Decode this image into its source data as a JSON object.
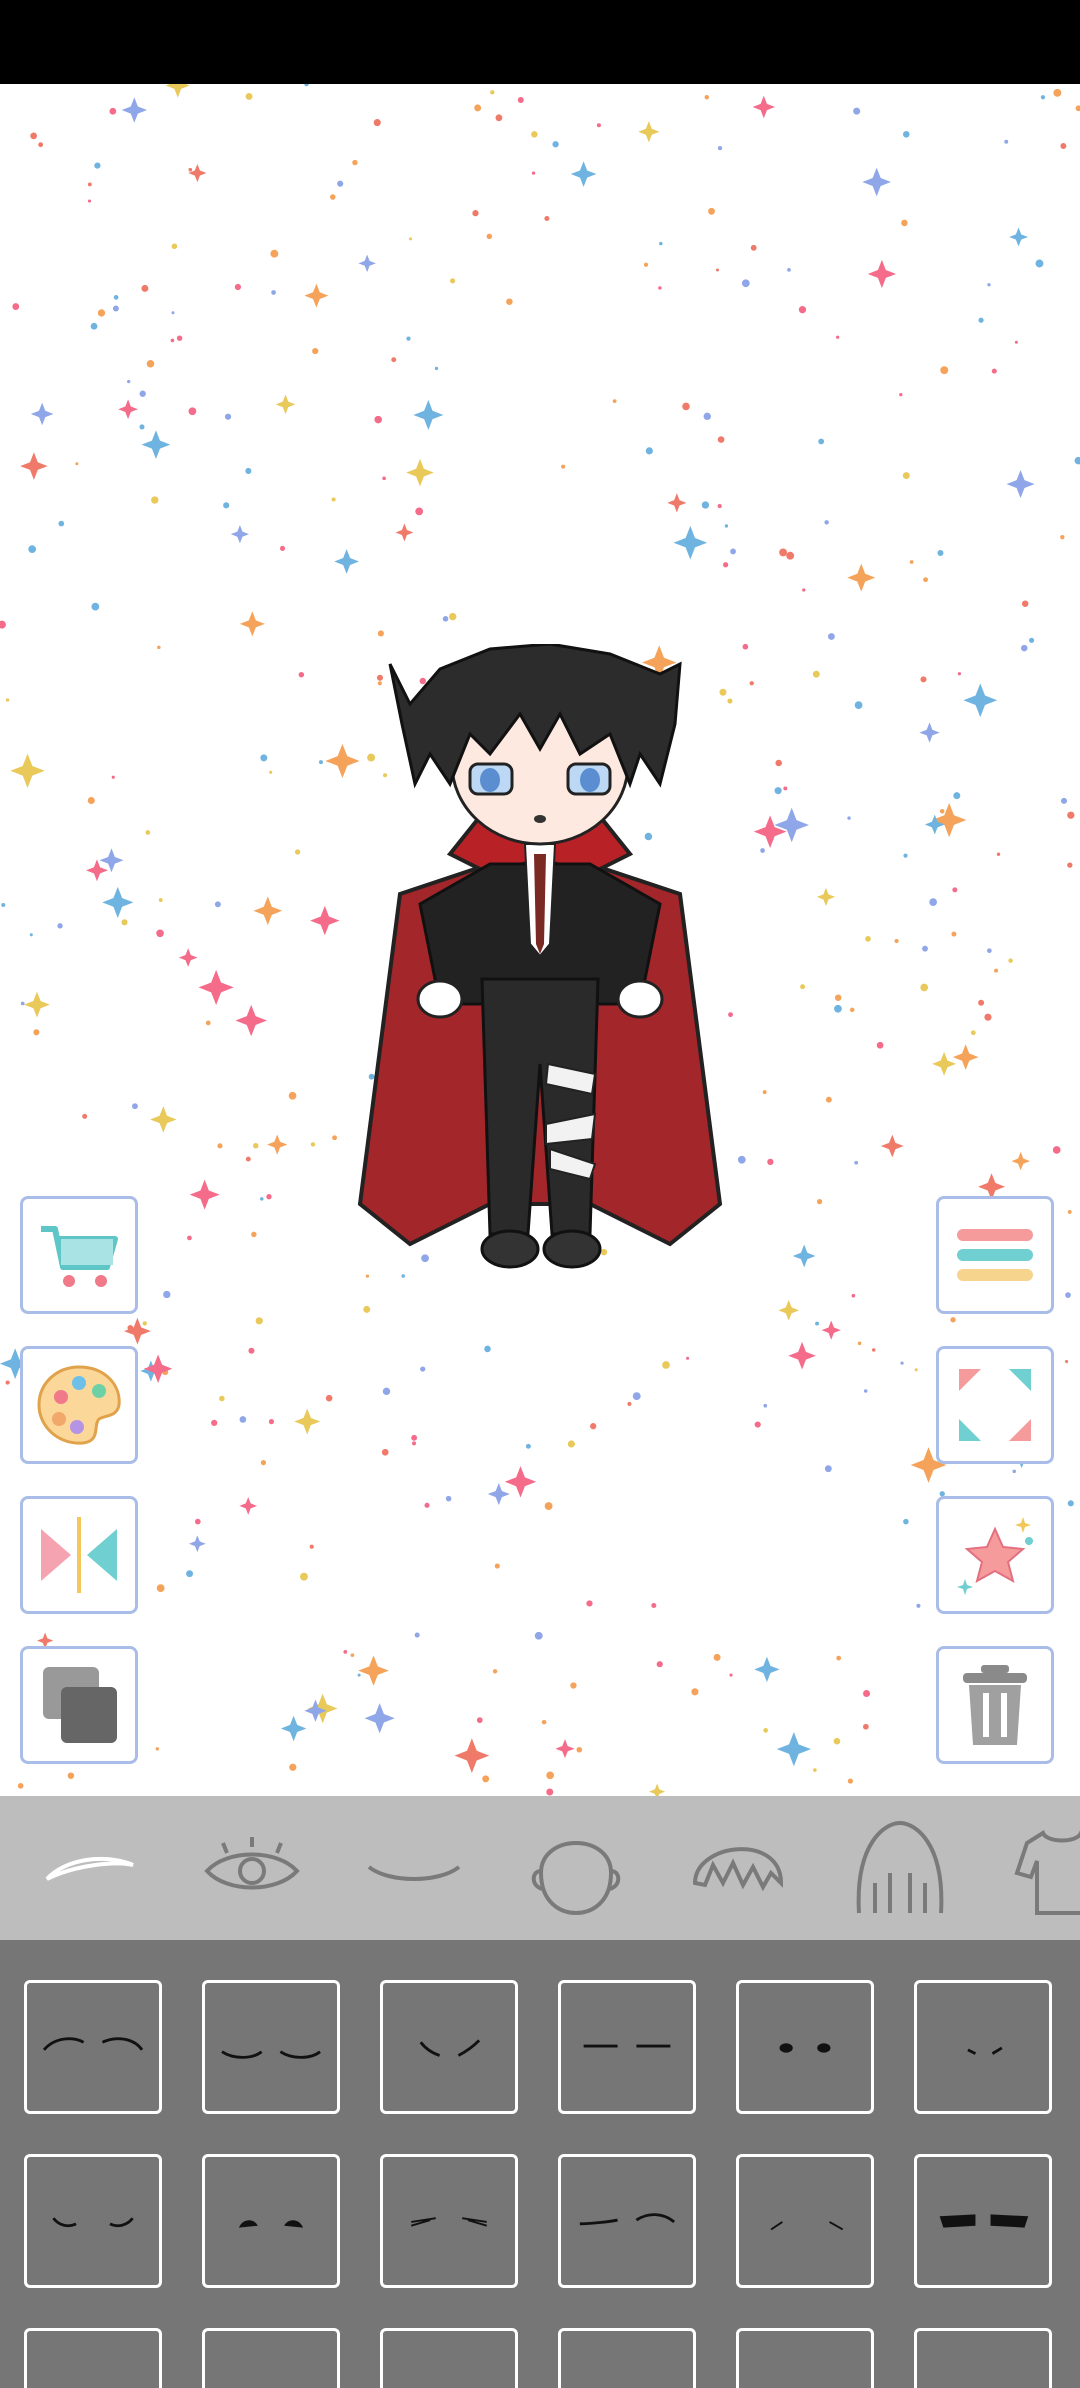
{
  "colors": {
    "canvas_bg": "#ffffff",
    "button_border": "#a9bde8",
    "tab_bar_bg": "#bdbdbd",
    "grid_bg": "#767676",
    "selected_tab_icon": "#ffffff",
    "tab_icon": "#7a7a7a"
  },
  "left_tools": [
    {
      "name": "shop-cart-icon"
    },
    {
      "name": "color-palette-icon"
    },
    {
      "name": "flip-mirror-icon"
    },
    {
      "name": "layers-icon"
    }
  ],
  "right_tools": [
    {
      "name": "menu-icon"
    },
    {
      "name": "fullscreen-icon"
    },
    {
      "name": "favorite-star-icon"
    },
    {
      "name": "trash-icon"
    }
  ],
  "tabs": [
    {
      "name": "eyebrow-icon",
      "selected": true
    },
    {
      "name": "eye-icon",
      "selected": false
    },
    {
      "name": "mouth-icon",
      "selected": false
    },
    {
      "name": "face-shape-icon",
      "selected": false
    },
    {
      "name": "bangs-icon",
      "selected": false
    },
    {
      "name": "hair-icon",
      "selected": false
    },
    {
      "name": "clothing-icon",
      "selected": false
    }
  ],
  "eyebrow_options": [
    {
      "name": "eyebrow-style-arched"
    },
    {
      "name": "eyebrow-style-soft-curve"
    },
    {
      "name": "eyebrow-style-angry"
    },
    {
      "name": "eyebrow-style-straight"
    },
    {
      "name": "eyebrow-style-dots"
    },
    {
      "name": "eyebrow-style-small-slant"
    },
    {
      "name": "eyebrow-style-drooped"
    },
    {
      "name": "eyebrow-style-thick-dots"
    },
    {
      "name": "eyebrow-style-sketchy"
    },
    {
      "name": "eyebrow-style-asymmetric"
    },
    {
      "name": "eyebrow-style-faint-slant"
    },
    {
      "name": "eyebrow-style-bold-bar"
    }
  ]
}
